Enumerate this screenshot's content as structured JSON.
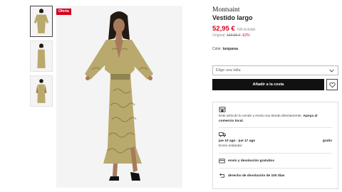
{
  "gallery": {
    "offer_badge": "Oferta",
    "colors": {
      "dress": "#b9a96d",
      "pattern": "#7c7244",
      "skin": "#a87a5a",
      "hair": "#231a16",
      "background": "#f4f4f4"
    }
  },
  "product": {
    "brand": "Montsaint",
    "name": "Vestido largo",
    "price": "52,95 €",
    "vat_note": "IVA incluido",
    "original_label": "Original:",
    "original_price": "139,95 €",
    "discount": "-62%",
    "color_label": "Color:",
    "color_value": "turquesa"
  },
  "purchase": {
    "size_placeholder": "Elige una talla",
    "add_to_cart_label": "Añadir a la cesta",
    "accent_color": "#111111",
    "sale_color": "#d6001c"
  },
  "shipping": {
    "seller_text": "Este artículo lo vende y envía una tienda directamente.",
    "seller_highlight": "Apoya al comercio local.",
    "delivery_dates": "jue 10 ago - jue 17 ago",
    "delivery_price": "gratis",
    "delivery_method": "Envío estándar:",
    "free_shipping": "envío y devolución gratuitos",
    "return_policy": "derecho de devolución de 100 días"
  }
}
